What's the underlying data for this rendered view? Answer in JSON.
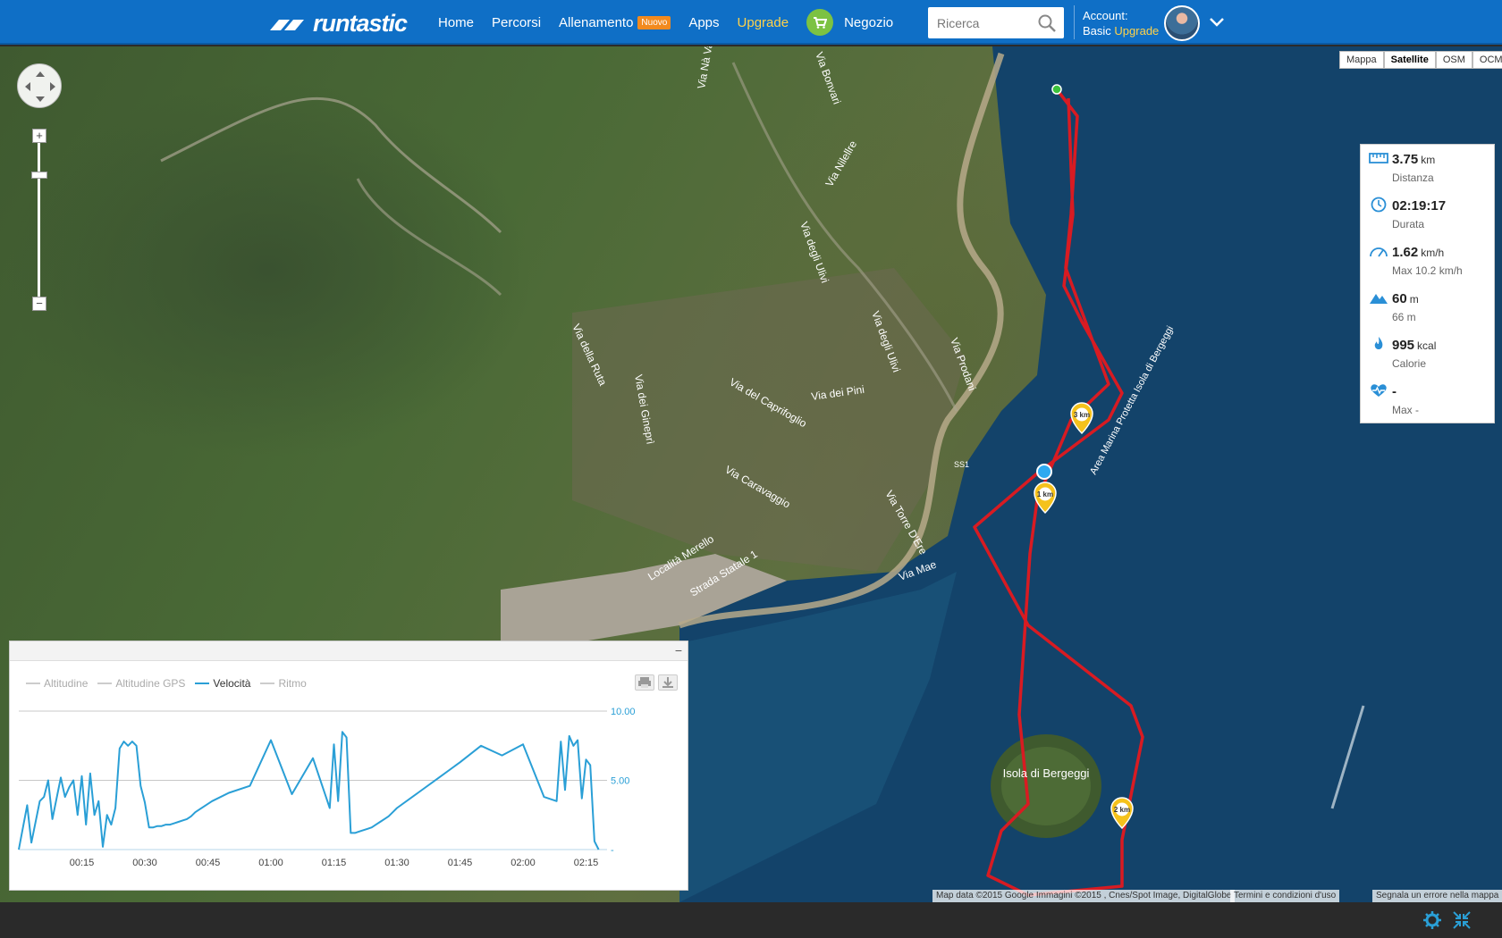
{
  "brand": {
    "name": "runtastic"
  },
  "nav": {
    "items": [
      {
        "label": "Home"
      },
      {
        "label": "Percorsi"
      },
      {
        "label": "Allenamento",
        "badge": "Nuovo"
      },
      {
        "label": "Apps"
      },
      {
        "label": "Upgrade"
      },
      {
        "label": "Negozio"
      }
    ]
  },
  "search": {
    "placeholder": "Ricerca"
  },
  "account": {
    "line1": "Account:",
    "plan": "Basic",
    "upgrade": "Upgrade"
  },
  "map": {
    "types": [
      "Mappa",
      "Satellite",
      "OSM",
      "OCM"
    ],
    "active_type": "Satellite",
    "labels": {
      "island": "Isola di Bergeggi",
      "area": "Area Marina Protetta Isola di Bergeggi",
      "road": "SS1",
      "streets": [
        "Via Nà Va",
        "Via Bonvari",
        "Via Nilellre",
        "Via degli Ulivi",
        "Via della Ruta",
        "Via dei Gineprì",
        "Via del Caprifoglio",
        "Via dei Pini",
        "Via Prodani",
        "Via degli Ulivi",
        "Via Caravaggio",
        "Via Torre D'Ere",
        "Località Merello",
        "Strada Statale 1",
        "Via Mae"
      ],
      "markers": [
        "1 km",
        "2 km",
        "3 km"
      ]
    },
    "attribution": [
      "Map data ©2015 Google Immagini ©2015 , Cnes/Spot Image, DigitalGlobe",
      "Termini e condizioni d'uso",
      "Segnala un errore nella mappa"
    ]
  },
  "stats": [
    {
      "icon": "ruler-icon",
      "value": "3.75",
      "unit": "km",
      "label": "Distanza"
    },
    {
      "icon": "clock-icon",
      "value": "02:19:17",
      "unit": "",
      "label": "Durata"
    },
    {
      "icon": "speed-icon",
      "value": "1.62",
      "unit": "km/h",
      "label": "Max 10.2 km/h"
    },
    {
      "icon": "mountain-icon",
      "value": "60",
      "unit": "m",
      "label": "66 m"
    },
    {
      "icon": "flame-icon",
      "value": "995",
      "unit": "kcal",
      "label": "Calorie"
    },
    {
      "icon": "heart-rate-icon",
      "value": "-",
      "unit": "",
      "label": "Max -"
    }
  ],
  "chart": {
    "legend": [
      "Altitudine",
      "Altitudine GPS",
      "Velocità",
      "Ritmo"
    ],
    "active": "Velocità",
    "accent": "#2a9fd6"
  },
  "chart_data": {
    "type": "line",
    "series": [
      {
        "name": "Velocità",
        "x": [
          0,
          2,
          3,
          5,
          6,
          7,
          8,
          10,
          11,
          12,
          13,
          14,
          15,
          16,
          17,
          18,
          19,
          20,
          21,
          22,
          23,
          24,
          25,
          26,
          27,
          28,
          29,
          30,
          31,
          32,
          33,
          34,
          35,
          36,
          37,
          38,
          39,
          40,
          41,
          42,
          43,
          46,
          50,
          55,
          60,
          65,
          70,
          74,
          75,
          76,
          77,
          78,
          79,
          80,
          81,
          82,
          83,
          84,
          85,
          86,
          87,
          88,
          89,
          90,
          95,
          100,
          105,
          110,
          115,
          120,
          125,
          128,
          129,
          130,
          131,
          132,
          133,
          134,
          135,
          136,
          137,
          138
        ],
        "y": [
          0,
          3.2,
          0.5,
          3.5,
          3.8,
          5,
          2.2,
          5.2,
          3.8,
          4.5,
          5,
          2.5,
          5.3,
          1.8,
          5.5,
          2.5,
          3.5,
          0.2,
          2.5,
          1.8,
          3,
          7.3,
          7.8,
          7.5,
          7.8,
          7.5,
          4.6,
          3.4,
          1.6,
          1.6,
          1.7,
          1.7,
          1.8,
          1.8,
          1.9,
          2,
          2.1,
          2.2,
          2.4,
          2.7,
          2.9,
          3.5,
          4.1,
          4.6,
          7.9,
          4,
          6.6,
          3,
          7.6,
          3.5,
          8.5,
          8.1,
          1.2,
          1.2,
          1.3,
          1.4,
          1.5,
          1.6,
          1.8,
          2,
          2.2,
          2.4,
          2.7,
          3,
          4.1,
          5.2,
          6.3,
          7.5,
          6.8,
          7.6,
          3.8,
          3.5,
          7.8,
          4.3,
          8.2,
          7.5,
          7.9,
          3.7,
          6.5,
          6.1,
          0.6,
          0
        ]
      }
    ],
    "xlabel": "",
    "ylabel": "",
    "x_ticks": [
      "00:15",
      "00:30",
      "00:45",
      "01:00",
      "01:15",
      "01:30",
      "01:45",
      "02:00",
      "02:15"
    ],
    "y_ticks": [
      "10.00",
      "5.00",
      "-"
    ],
    "ylim": [
      0,
      10
    ],
    "grid": true
  }
}
